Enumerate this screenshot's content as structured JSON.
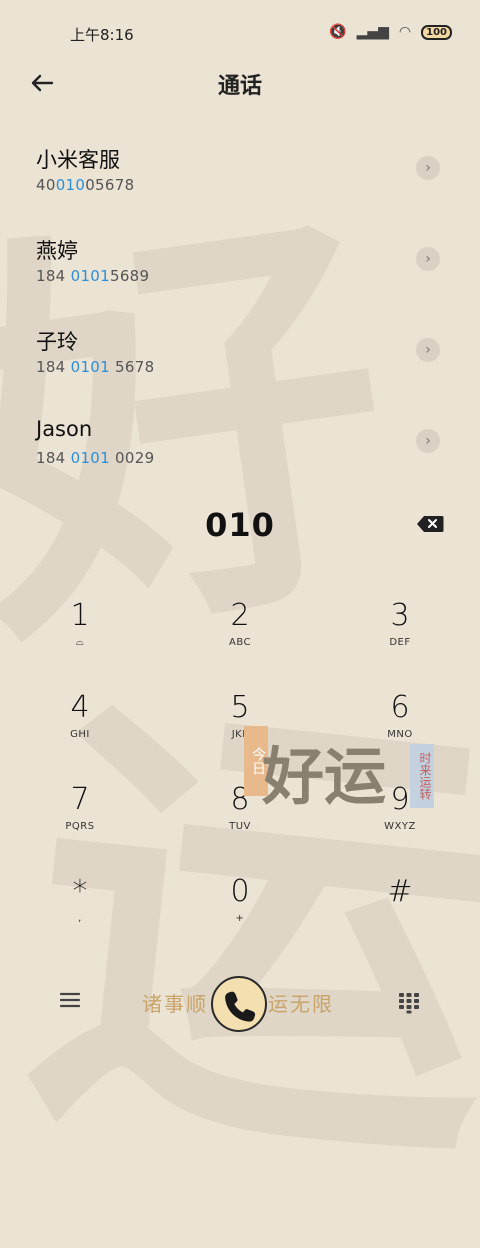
{
  "status_bar": {
    "time": "上午8:16",
    "battery": "100"
  },
  "header": {
    "title": "通话"
  },
  "contacts": [
    {
      "name": "小米客服",
      "num_before": "40",
      "num_match": "010",
      "num_after": "05678"
    },
    {
      "name": "燕婷",
      "num_before": "184 ",
      "num_match": "0101",
      "num_after": "5689"
    },
    {
      "name": "子玲",
      "num_before": "184 ",
      "num_match": "0101",
      "num_after": " 5678"
    },
    {
      "name": "Jason",
      "num_before": "184 ",
      "num_match": "0101",
      "num_after": " 0029"
    }
  ],
  "dial_input": "010",
  "keys": [
    {
      "digit": "1",
      "letters": "⌂"
    },
    {
      "digit": "2",
      "letters": "ABC"
    },
    {
      "digit": "3",
      "letters": "DEF"
    },
    {
      "digit": "4",
      "letters": "GHI"
    },
    {
      "digit": "5",
      "letters": "JKL"
    },
    {
      "digit": "6",
      "letters": "MNO"
    },
    {
      "digit": "7",
      "letters": "PQRS"
    },
    {
      "digit": "8",
      "letters": "TUV"
    },
    {
      "digit": "9",
      "letters": "WXYZ"
    },
    {
      "digit": "*",
      "letters": ","
    },
    {
      "digit": "0",
      "letters": "+"
    },
    {
      "digit": "#",
      "letters": ""
    }
  ],
  "bottom": {
    "slogan_left": "诸事顺",
    "slogan_right": "运无限"
  },
  "sticker": {
    "big_text": "好运",
    "tag_left": "今日",
    "tag_right": "时来运转"
  },
  "colors": {
    "highlight": "#2b8fd9",
    "background": "#ebe3d4",
    "call_button": "#f3dfb0"
  }
}
